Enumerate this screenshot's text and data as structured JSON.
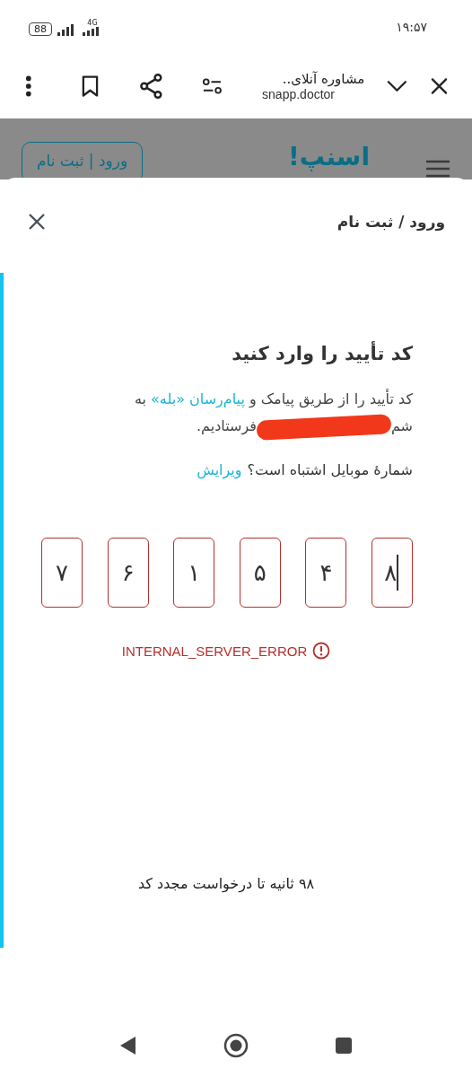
{
  "status_bar": {
    "time": "۱۹:۵۷",
    "battery": "88",
    "network": "4G"
  },
  "browser_bar": {
    "title": "مشاوره آنلای..",
    "url": "snapp.doctor"
  },
  "site_header": {
    "logo": "اسنپ!",
    "login_button": "ورود | ثبت نام"
  },
  "sheet": {
    "title": "ورود / ثبت نام",
    "heading": "کد تأیید را وارد کنید",
    "message_lines": [
      [
        {
          "kind": "plain",
          "text": "کد تأیید را از طریق پیامک و "
        },
        {
          "kind": "link",
          "text": "پیام‌رسان «بله»"
        },
        {
          "kind": "plain",
          "text": " به"
        }
      ],
      [
        {
          "kind": "plain",
          "text": "شم"
        },
        {
          "kind": "redacted"
        },
        {
          "kind": "plain",
          "text": "فرستادیم."
        }
      ]
    ],
    "edit_prompt": "شمارهٔ موبایل اشتباه است؟",
    "edit_link": "ویرایش",
    "code_boxes": [
      {
        "value": "۸",
        "focused": true
      },
      {
        "value": "۴",
        "focused": false
      },
      {
        "value": "۵",
        "focused": false
      },
      {
        "value": "۱",
        "focused": false
      },
      {
        "value": "۶",
        "focused": false
      },
      {
        "value": "۷",
        "focused": false
      }
    ],
    "error": "INTERNAL_SERVER_ERROR",
    "countdown": "۹۸ ثانیه تا درخواست مجدد کد"
  }
}
